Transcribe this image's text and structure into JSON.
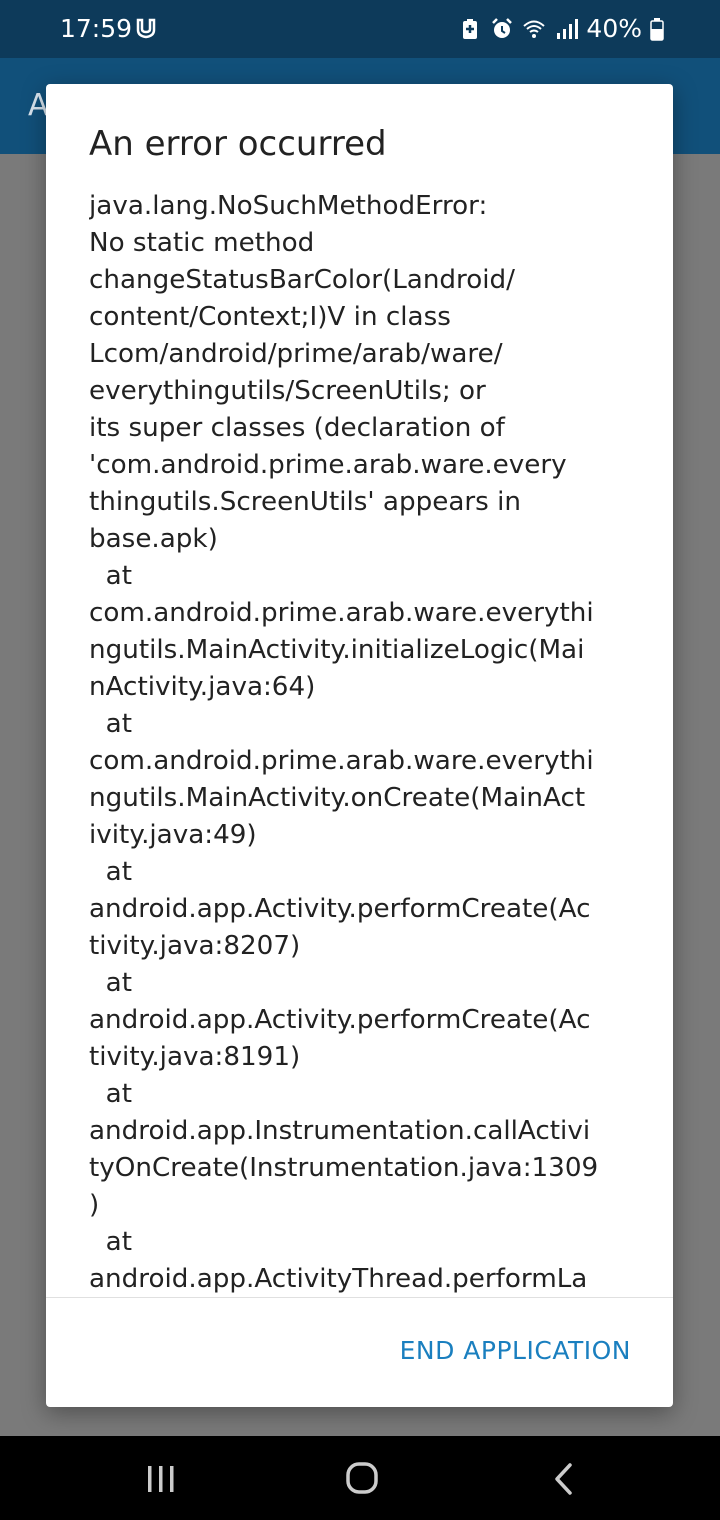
{
  "status_bar": {
    "time": "17:59",
    "battery": "40%"
  },
  "app_bar": {
    "title": "A"
  },
  "dialog": {
    "title": "An error occurred",
    "message": "java.lang.NoSuchMethodError:\nNo static method\nchangeStatusBarColor(Landroid/\ncontent/Context;I)V in class\nLcom/android/prime/arab/ware/\neverythingutils/ScreenUtils; or\nits super classes (declaration of\n'com.android.prime.arab.ware.every\nthingutils.ScreenUtils' appears in\nbase.apk)\n  at\ncom.android.prime.arab.ware.everythi\nngutils.MainActivity.initializeLogic(Mai\nnActivity.java:64)\n  at\ncom.android.prime.arab.ware.everythi\nngutils.MainActivity.onCreate(MainAct\nivity.java:49)\n  at\nandroid.app.Activity.performCreate(Ac\ntivity.java:8207)\n  at\nandroid.app.Activity.performCreate(Ac\ntivity.java:8191)\n  at\nandroid.app.Instrumentation.callActivi\ntyOnCreate(Instrumentation.java:1309\n)\n  at\nandroid.app.ActivityThread.performLa",
    "button_label": "END APPLICATION"
  },
  "colors": {
    "status_bar": "#0d3a5a",
    "app_bar": "#11507a",
    "accent": "#1a7fbf"
  },
  "icons": [
    "notification-icon",
    "battery-saver-icon",
    "alarm-icon",
    "wifi-icon",
    "signal-icon",
    "battery-icon",
    "recents-icon",
    "home-icon",
    "back-icon"
  ]
}
